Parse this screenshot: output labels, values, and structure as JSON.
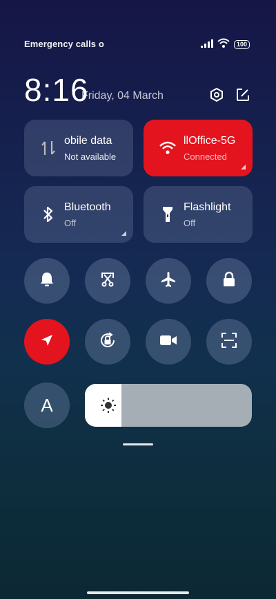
{
  "status": {
    "carrier_text": "Emergency calls o",
    "battery": "100"
  },
  "header": {
    "time": "8:16",
    "date": "Friday, 04 March"
  },
  "tiles": {
    "mobile_data": {
      "title": "obile data",
      "subtitle": "Not available"
    },
    "wifi": {
      "title": "llOffice-5G",
      "subtitle": "Connected",
      "active": true
    },
    "bluetooth": {
      "title": "Bluetooth",
      "subtitle": "Off"
    },
    "flashlight": {
      "title": "Flashlight",
      "subtitle": "Off"
    }
  },
  "toggles_row1": [
    {
      "icon": "bell-icon"
    },
    {
      "icon": "screenshot-scissors-icon"
    },
    {
      "icon": "airplane-icon"
    },
    {
      "icon": "lock-icon"
    }
  ],
  "toggles_row2": [
    {
      "icon": "location-icon",
      "active": true
    },
    {
      "icon": "rotation-lock-icon"
    },
    {
      "icon": "video-camera-icon"
    },
    {
      "icon": "scan-icon"
    }
  ],
  "auto_brightness_label": "A",
  "brightness_level": 0.22,
  "colors": {
    "accent_red": "#e3141e",
    "tile_bg": "rgba(150,170,200,0.22)"
  }
}
